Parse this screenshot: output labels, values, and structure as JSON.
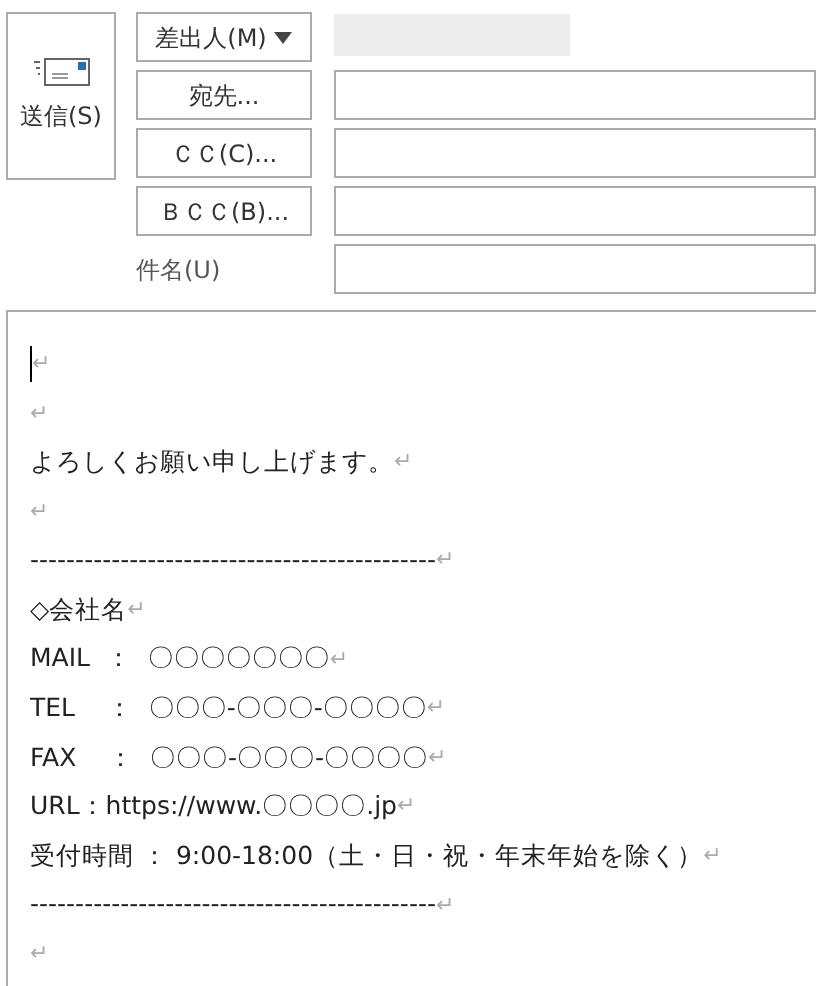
{
  "send_button": {
    "label": "送信(S)"
  },
  "sender_button": {
    "label": "差出人(M)"
  },
  "address_buttons": [
    {
      "label": "宛先..."
    },
    {
      "label": "ＣＣ(C)..."
    },
    {
      "label": "ＢＣＣ(B)..."
    }
  ],
  "subject": {
    "label": "件名(U)"
  },
  "body": {
    "lines": [
      {
        "mark": "↵",
        "caret": true
      },
      {
        "mark": "↵",
        "caret": false
      },
      {
        "text": "よろしくお願い申し上げます。",
        "mark": "↵",
        "caret": false
      },
      {
        "mark": "↵",
        "caret": false
      },
      {
        "text": "---------------------------------------------",
        "mark": "↵",
        "caret": false
      },
      {
        "text": "◇会社名",
        "mark": "↵",
        "caret": false
      },
      {
        "text": "MAIL  ：  〇〇〇〇〇〇〇",
        "mark": "↵",
        "caret": false
      },
      {
        "text": "TEL    ：  〇〇〇-〇〇〇-〇〇〇〇",
        "mark": "↵",
        "caret": false
      },
      {
        "text": "FAX    ：  〇〇〇-〇〇〇-〇〇〇〇",
        "mark": "↵",
        "caret": false
      },
      {
        "text": "URL：https://www.〇〇〇〇.jp",
        "mark": "↵",
        "caret": false
      },
      {
        "text": "受付時間 ： 9:00-18:00（土・日・祝・年末年始を除く）",
        "mark": "↵",
        "caret": false
      },
      {
        "text": "---------------------------------------------",
        "mark": "↵",
        "caret": false
      },
      {
        "mark": "↵",
        "caret": false
      }
    ]
  }
}
